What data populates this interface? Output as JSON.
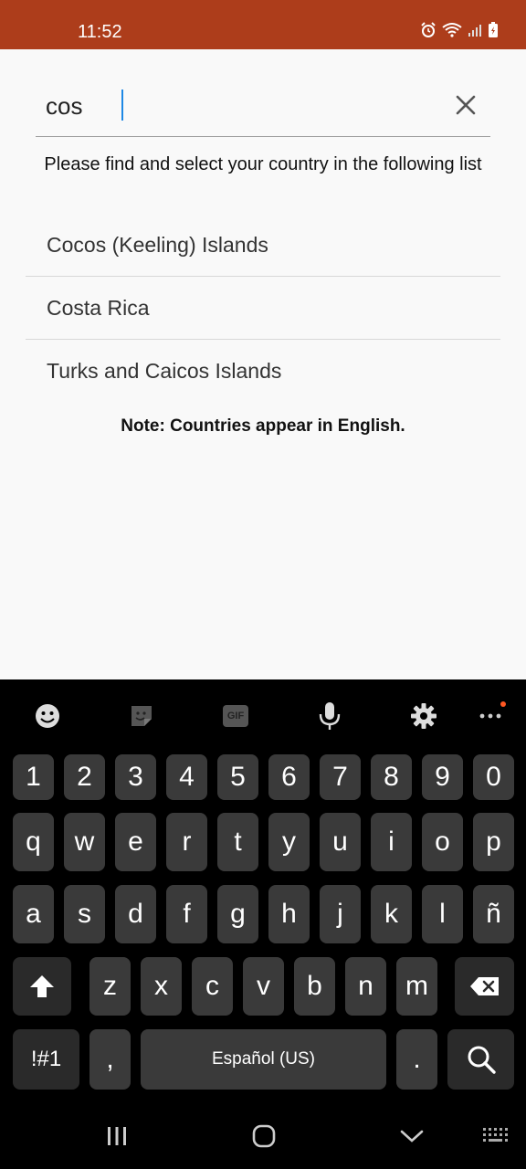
{
  "status_bar": {
    "time": "11:52",
    "icons": [
      "alarm-icon",
      "wifi-icon",
      "signal-icon",
      "battery-charging-icon"
    ]
  },
  "search": {
    "value": "cos"
  },
  "instructions": "Please find and select your country in the following list",
  "countries": [
    "Cocos (Keeling) Islands",
    "Costa Rica",
    "Turks and Caicos Islands"
  ],
  "note": "Note: Countries appear in English.",
  "keyboard": {
    "toolbar": [
      "emoji-icon",
      "sticker-icon",
      "gif-icon",
      "microphone-icon",
      "settings-icon",
      "more-icon"
    ],
    "gif_label": "GIF",
    "row_numbers": [
      "1",
      "2",
      "3",
      "4",
      "5",
      "6",
      "7",
      "8",
      "9",
      "0"
    ],
    "row_1": [
      "q",
      "w",
      "e",
      "r",
      "t",
      "y",
      "u",
      "i",
      "o",
      "p"
    ],
    "row_2": [
      "a",
      "s",
      "d",
      "f",
      "g",
      "h",
      "j",
      "k",
      "l",
      "ñ"
    ],
    "row_3": [
      "z",
      "x",
      "c",
      "v",
      "b",
      "n",
      "m"
    ],
    "symbols_label": "!#1",
    "comma_label": ",",
    "space_label": "Español (US)",
    "period_label": "."
  },
  "nav": [
    "recent-apps-icon",
    "home-icon",
    "back-icon",
    "keyboard-switch-icon"
  ],
  "colors": {
    "status_bar": "#ad3d1b",
    "caret": "#1e88e5",
    "key": "#3a3a3a",
    "app_bg": "#f9f9f9"
  }
}
